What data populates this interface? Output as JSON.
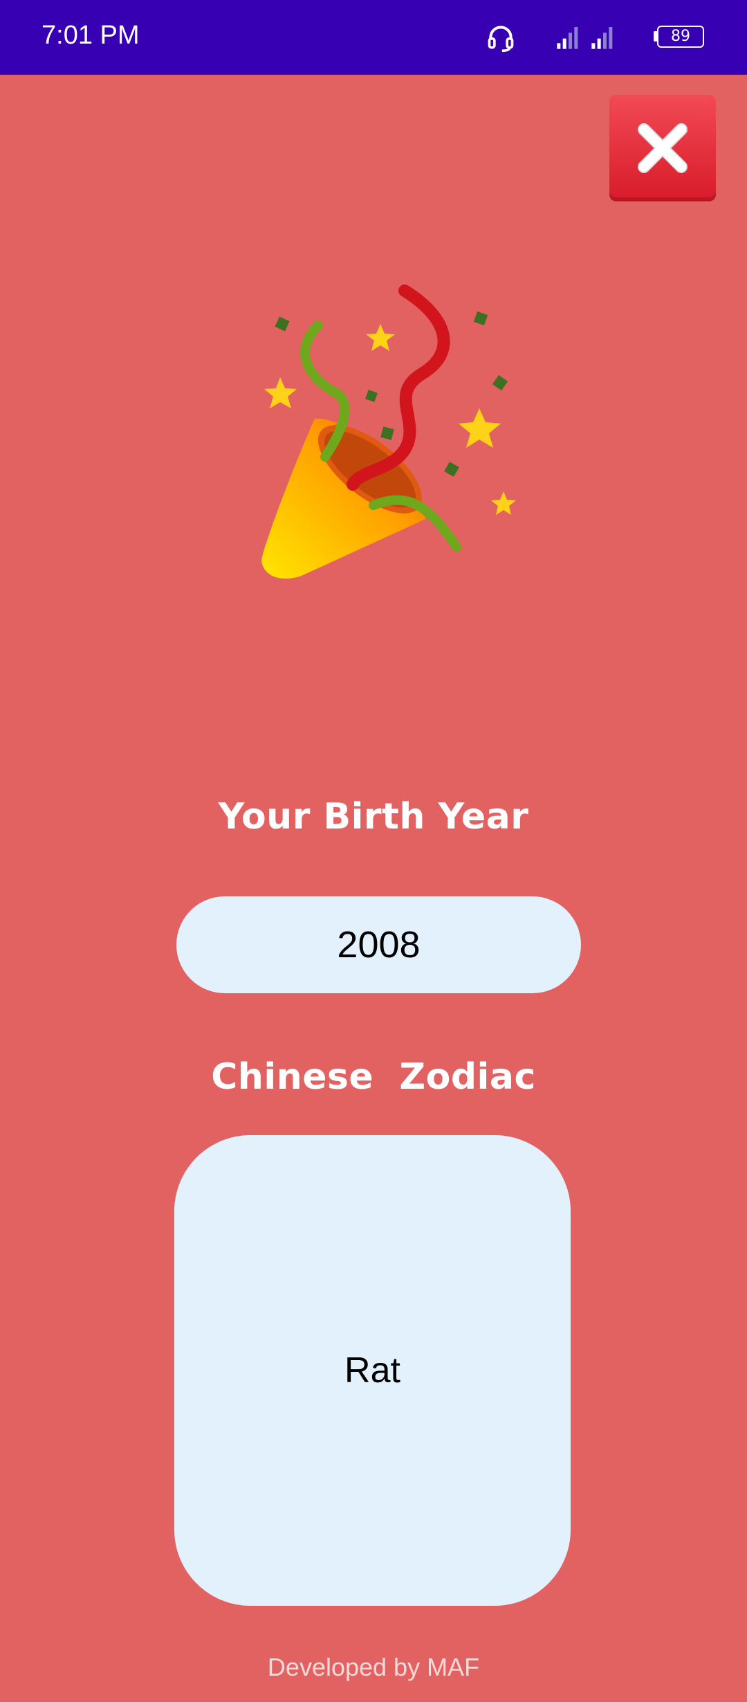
{
  "status_bar": {
    "time": "7:01 PM",
    "battery": "89",
    "icons": [
      "headset-icon",
      "signal-icon",
      "signal-icon",
      "battery-icon"
    ]
  },
  "close_button": {
    "icon": "close-icon"
  },
  "hero": {
    "icon": "party-popper-icon"
  },
  "birth_year": {
    "label": "Your Birth Year",
    "value": "2008"
  },
  "zodiac": {
    "label": "Chinese  Zodiac",
    "value": "Rat"
  },
  "footer": {
    "text": "Developed by MAF"
  },
  "colors": {
    "background": "#e26262",
    "status_bar": "#3700b3",
    "field_background": "#e3f1fd",
    "close_button": "#e32a38"
  }
}
